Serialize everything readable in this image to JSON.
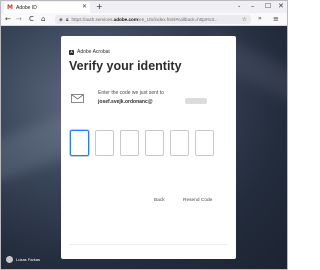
{
  "browser": {
    "tab": {
      "title": "Adobe ID",
      "favicon": "gmail-m-icon"
    },
    "new_tab_symbol": "+",
    "tab_list_symbol": "⌄",
    "window_controls": {
      "minimize": "–",
      "maximize": "☐",
      "close": "✕"
    },
    "nav": {
      "back": "←",
      "forward": "→",
      "reload": "C",
      "home": "⌂"
    },
    "url": {
      "prefix": "https://auth.services.",
      "domain": "adobe.com",
      "suffix": "/en_US/index.html#callback=https%3..."
    },
    "overflow": "»",
    "menu": "≡"
  },
  "background": {
    "credit": "Lukas Farkas"
  },
  "dialog": {
    "brand": "Adobe Acrobat",
    "title": "Verify your identity",
    "message": "Enter the code we just sent to",
    "email": "josef.svejk.ordonanc@",
    "code_digits": [
      "",
      "",
      "",
      "",
      "",
      ""
    ],
    "back_label": "Back",
    "resend_label": "Resend Code"
  },
  "colors": {
    "accent": "#2680eb",
    "gmail_red": "#e0301e",
    "background_dark": "#232c3c"
  }
}
